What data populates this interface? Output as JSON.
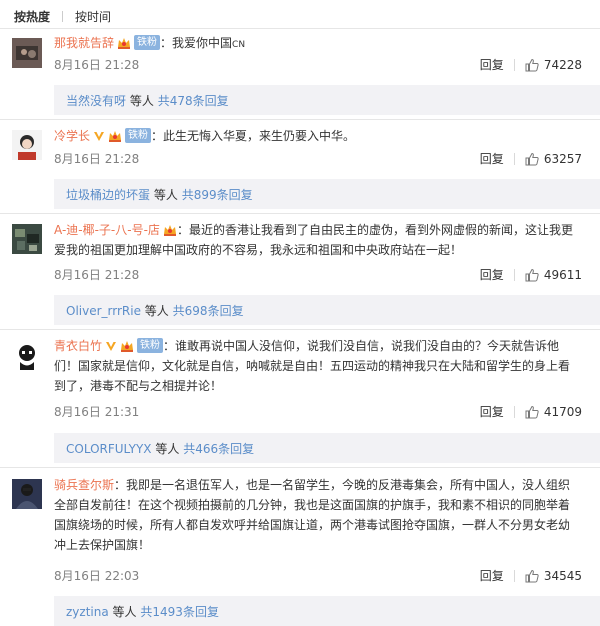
{
  "tabs": {
    "hot": "按热度",
    "time": "按时间"
  },
  "common": {
    "reply": "回复",
    "fan_badge": "铁粉",
    "colon": "：",
    "and_others": "等人",
    "total_prefix": "共",
    "total_suffix": "条回复"
  },
  "comments": [
    {
      "user": "那我就告辞",
      "badges": [
        "crown"
      ],
      "fan": true,
      "text": "我爱你中国",
      "text_suffix": "CN",
      "time": "8月16日 21:28",
      "likes": "74228",
      "reply_user": "当然没有呀",
      "reply_count": "478"
    },
    {
      "user": "冷学长",
      "badges": [
        "v",
        "crown"
      ],
      "fan": true,
      "text": "此生无悔入华夏，来生仍要入中华。",
      "time": "8月16日 21:28",
      "likes": "63257",
      "reply_user": "垃圾桶边的坏蛋",
      "reply_count": "899"
    },
    {
      "user": "A-迪-椰-子-八-号-店",
      "badges": [
        "crown"
      ],
      "fan": false,
      "line1": "最近的香港让我看到了自由民主的虚伪，看到外网虚假的新闻，这让我更",
      "line2": "爱我的祖国更加理解中国政府的不容易，我永远和祖国和中央政府站在一起！",
      "time": "8月16日 21:28",
      "likes": "49611",
      "reply_user": "Oliver_rrrRie",
      "reply_count": "698"
    },
    {
      "user": "青衣白竹",
      "badges": [
        "v",
        "crown"
      ],
      "fan": true,
      "line1": "谁敢再说中国人没信仰，说我们没自信，说我们没自由的？今天就告诉他",
      "line2": "们！国家就是信仰，文化就是自信，呐喊就是自由！五四运动的精神我只在大陆和留学生的身上看",
      "line3": "到了，港毒不配与之相提并论！",
      "time": "8月16日 21:31",
      "likes": "41709",
      "reply_user": "COLORFULYYX",
      "reply_count": "466"
    },
    {
      "user": "骑兵查尔斯",
      "badges": [],
      "fan": false,
      "line1": "我即是一名退伍军人，也是一名留学生，今晚的反港毒集会，所有中国人，没人组织",
      "line2": "全部自发前往！在这个视频拍摄前的几分钟，我也是这面国旗的护旗手，我和素不相识的同胞举着",
      "line3": "国旗绕场的时候，所有人都自发欢呼并给国旗让道，两个港毒试图抢夺国旗，一群人不分男女老幼",
      "line4": "冲上去保护国旗！",
      "time": "8月16日 22:03",
      "likes": "34545",
      "reply_user": "zyztina",
      "reply_count": "1493"
    }
  ]
}
